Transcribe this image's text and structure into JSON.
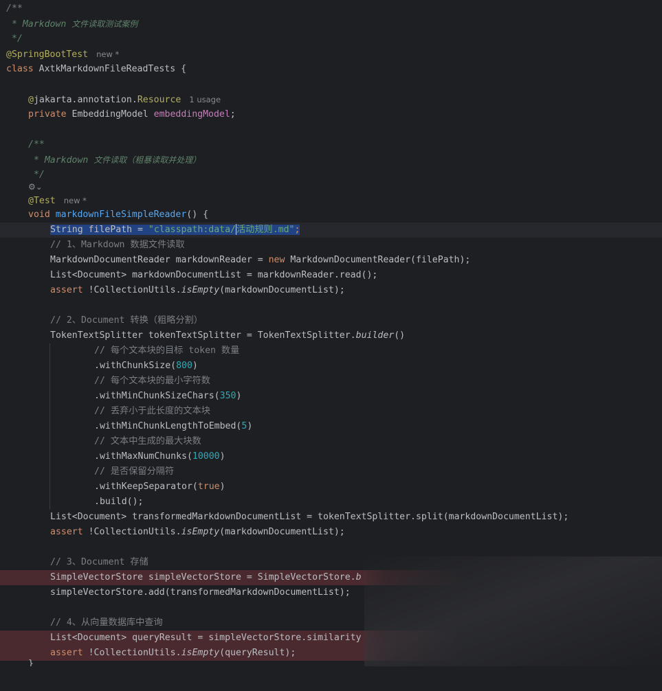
{
  "lines": {
    "l1": "/**",
    "l2a": " * Markdown ",
    "l2b": "文件读取测试案例",
    "l3": " */",
    "l4_ann": "@SpringBootTest",
    "l4_hint": "new *",
    "l5_kw": "class",
    "l5_rest": " AxtkMarkdownFileReadTests {",
    "l7_at": "@",
    "l7_pkg": "jakarta.annotation.",
    "l7_ann": "Resource",
    "l7_hint": "1 usage",
    "l8_kw": "private",
    "l8_type": " EmbeddingModel ",
    "l8_field": "embeddingModel",
    "l8_end": ";",
    "l10": "/**",
    "l11a": " * Markdown ",
    "l11b": "文件读取（粗暴读取并处理）",
    "l12": " */",
    "l13_icon": "⚙",
    "l13_chev": "⌄",
    "l14_ann": "@Test",
    "l14_hint": "new *",
    "l15_kw": "void",
    "l15_fn": " markdownFileSimpleReader",
    "l15_end": "() {",
    "l16_a": "String filePath = ",
    "l16_b": "\"classpath:data/",
    "l16_c": "活动规则.md\"",
    "l16_d": ";",
    "l17": "// 1、Markdown 数据文件读取",
    "l18_a": "MarkdownDocumentReader markdownReader = ",
    "l18_kw": "new",
    "l18_b": " MarkdownDocumentReader(filePath);",
    "l19": "List<Document> markdownDocumentList = markdownReader.read();",
    "l20_kw": "assert",
    "l20_a": " !CollectionUtils.",
    "l20_m": "isEmpty",
    "l20_b": "(markdownDocumentList);",
    "l22": "// 2、Document 转换（粗略分割）",
    "l23_a": "TokenTextSplitter tokenTextSplitter = TokenTextSplitter.",
    "l23_m": "builder",
    "l23_b": "()",
    "l24": "// 每个文本块的目标 token 数量",
    "l25_a": ".withChunkSize(",
    "l25_n": "800",
    "l25_b": ")",
    "l26": "// 每个文本块的最小字符数",
    "l27_a": ".withMinChunkSizeChars(",
    "l27_n": "350",
    "l27_b": ")",
    "l28": "// 丢弃小于此长度的文本块",
    "l29_a": ".withMinChunkLengthToEmbed(",
    "l29_n": "5",
    "l29_b": ")",
    "l30": "// 文本中生成的最大块数",
    "l31_a": ".withMaxNumChunks(",
    "l31_n": "10000",
    "l31_b": ")",
    "l32": "// 是否保留分隔符",
    "l33_a": ".withKeepSeparator(",
    "l33_kw": "true",
    "l33_b": ")",
    "l34": ".build();",
    "l35": "List<Document> transformedMarkdownDocumentList = tokenTextSplitter.split(markdownDocumentList);",
    "l36_kw": "assert",
    "l36_a": " !CollectionUtils.",
    "l36_m": "isEmpty",
    "l36_b": "(markdownDocumentList);",
    "l38": "// 3、Document 存储",
    "l39_a": "SimpleVectorStore simpleVectorStore = SimpleVectorStore.",
    "l39_m": "b",
    "l40": "simpleVectorStore.add(transformedMarkdownDocumentList);",
    "l42": "// 4、从向量数据库中查询",
    "l43": "List<Document> queryResult = simpleVectorStore.similarity",
    "l44_kw": "assert",
    "l44_a": " !CollectionUtils.",
    "l44_m": "isEmpty",
    "l44_b": "(queryResult);",
    "l45": "}"
  }
}
